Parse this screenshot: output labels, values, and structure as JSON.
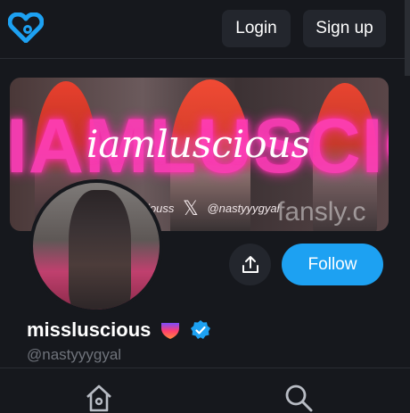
{
  "header": {
    "login_label": "Login",
    "signup_label": "Sign up"
  },
  "banner": {
    "big_text": "IAMLUSCIOUS",
    "script_text": "iamluscious",
    "handle_left": "iamlusciouss",
    "handle_right": "@nastyyygyal",
    "watermark": "fansly.c"
  },
  "profile": {
    "display_name": "missluscious",
    "username": "@nastyyygyal",
    "follow_label": "Follow"
  },
  "colors": {
    "accent": "#1da1f2",
    "logo": "#1da1f2",
    "neon_pink": "#ff3db8",
    "background": "#16181d"
  },
  "icons": {
    "logo": "fansly-heart-logo-icon",
    "share": "share-icon",
    "verified": "verified-badge-icon",
    "badge": "gradient-shield-badge-icon",
    "home": "home-icon",
    "search": "search-icon",
    "banner_x": "x-logo-icon"
  }
}
